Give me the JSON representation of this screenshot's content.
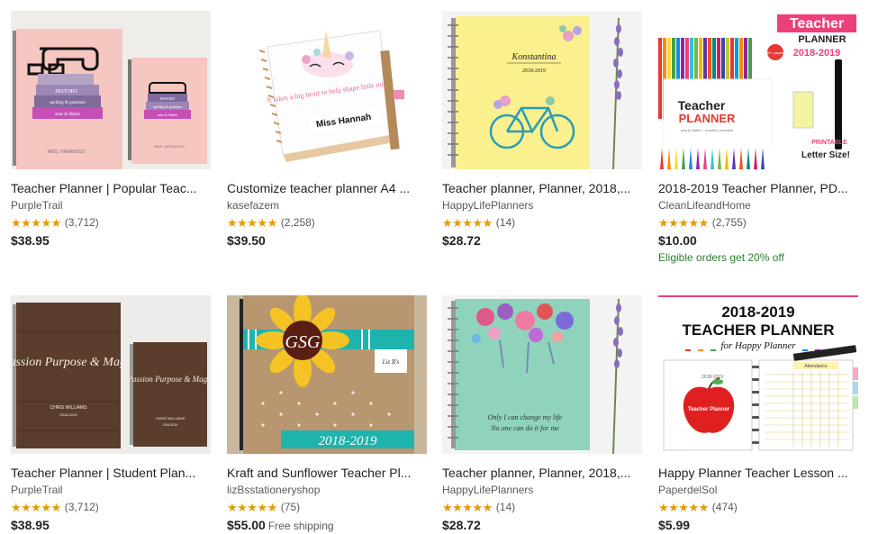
{
  "listings": [
    {
      "title": "Teacher Planner | Popular Teac...",
      "shop": "PurpleTrail",
      "stars": "★★★★★",
      "reviews": "(3,712)",
      "price": "$38.95",
      "extra": "",
      "promo": ""
    },
    {
      "title": "Customize teacher planner A4 ...",
      "shop": "kasefazem",
      "stars": "★★★★★",
      "reviews": "(2,258)",
      "price": "$39.50",
      "extra": "",
      "promo": ""
    },
    {
      "title": "Teacher planner, Planner, 2018,...",
      "shop": "HappyLifePlanners",
      "stars": "★★★★★",
      "reviews": "(14)",
      "price": "$28.72",
      "extra": "",
      "promo": ""
    },
    {
      "title": "2018-2019 Teacher Planner, PD...",
      "shop": "CleanLifeandHome",
      "stars": "★★★★★",
      "reviews": "(2,755)",
      "price": "$10.00",
      "extra": "",
      "promo": "Eligible orders get 20% off"
    },
    {
      "title": "Teacher Planner | Student Plan...",
      "shop": "PurpleTrail",
      "stars": "★★★★★",
      "reviews": "(3,712)",
      "price": "$38.95",
      "extra": "",
      "promo": ""
    },
    {
      "title": "Kraft and Sunflower Teacher Pl...",
      "shop": "lizBsstationeryshop",
      "stars": "★★★★★",
      "reviews": "(75)",
      "price": "$55.00",
      "extra": "Free shipping",
      "promo": ""
    },
    {
      "title": "Teacher planner, Planner, 2018,...",
      "shop": "HappyLifePlanners",
      "stars": "★★★★★",
      "reviews": "(14)",
      "price": "$28.72",
      "extra": "",
      "promo": ""
    },
    {
      "title": "Happy Planner Teacher Lesson ...",
      "shop": "PaperdelSol",
      "stars": "★★★★★",
      "reviews": "(474)",
      "price": "$5.99",
      "extra": "",
      "promo": ""
    }
  ],
  "images": {
    "img0": {
      "book_lines": [
        "HISTORY",
        "spelling & grammar",
        "stats & Maths"
      ],
      "small_lines": [
        "HISTORY",
        "spelling & grammar",
        "stats & Maths"
      ],
      "name": "MRS. HIRAWOOD",
      "small_name": "MRS. HIRAWOOD"
    },
    "img1": {
      "quote": "It takes a big heart to help shape little minds",
      "name": "Miss Hannah"
    },
    "img2": {
      "name": "Konstantina",
      "year": "2018-2019"
    },
    "img3": {
      "badge_word1": "Teacher",
      "badge_word2": "PLANNER",
      "badge_years": "2018-2019",
      "pages": "80+ pages!",
      "cover_title1": "Teacher",
      "cover_title2": "PLANNER",
      "cover_sub": "yearly edition · monthly overview",
      "printable": "PRINTABLE",
      "size": "Letter Size!"
    },
    "img4": {
      "big_script": "Passion Purpose & Magic",
      "small_script": "Passion Purpose & Magic",
      "name": "CHRIS WILLIAMS",
      "year": "2018-2019",
      "small_name": "CHRIS WILLIAMS",
      "small_year": "2018-2019"
    },
    "img5": {
      "monogram": "GSG",
      "year": "2018-2019",
      "logo": "Liz B's"
    },
    "img6": {
      "quote_line1": "Only I can change my life",
      "quote_line2": "No one can do it for me"
    },
    "img7": {
      "line1": "2018-2019",
      "line2": "TEACHER PLANNER",
      "line3": "for Happy Planner",
      "year_small": "2018-2019",
      "apple_label": "Teacher Planner",
      "tab": "Attendance"
    }
  },
  "colors": {
    "star": "#e29b00",
    "promo": "#2e7d32"
  }
}
